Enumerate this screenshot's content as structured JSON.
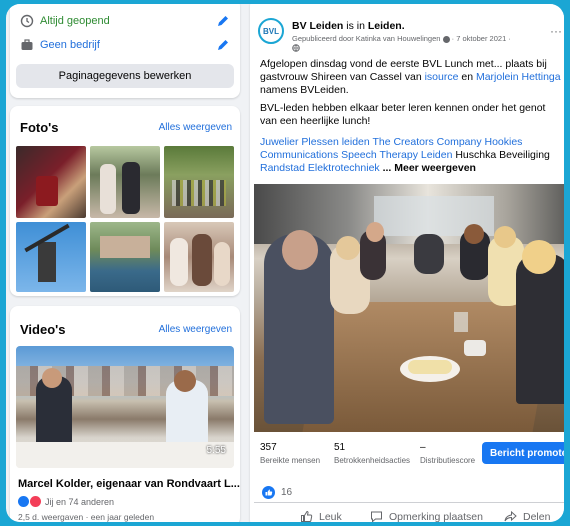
{
  "left": {
    "info": {
      "always_open": "Altijd geopend",
      "no_company": "Geen bedrijf",
      "edit_button": "Paginagegevens bewerken"
    },
    "photos": {
      "title": "Foto's",
      "see_all": "Alles weergeven"
    },
    "videos": {
      "title": "Video's",
      "see_all": "Alles weergeven",
      "duration": "5:55",
      "video_title": "Marcel Kolder, eigenaar van Rondvaart L...",
      "reactions": "Jij en 74 anderen",
      "meta": "2,5 d. weergaven · een jaar geleden"
    }
  },
  "post": {
    "avatar_text": "BVL",
    "page_name": "BV Leiden",
    "is_in": " is in ",
    "location": "Leiden.",
    "published_by": "Gepubliceerd door Katinka van Houwelingen",
    "date": "· 7 oktober 2021 ·",
    "more": "···",
    "p1_a": "Afgelopen dinsdag vond de eerste BVL Lunch met... plaats bij gastvrouw Shireen van Cassel van ",
    "p1_link1": "isource",
    "p1_b": " en ",
    "p1_link2": "Marjolein Hettinga",
    "p1_c": " namens BVLeiden.",
    "p2": "BVL-leden hebben elkaar beter leren kennen onder het genot van een heerlijke lunch!",
    "p3_links": "Juwelier Plessen leiden The Creators Company Hookies Communications  Speech Therapy Leiden",
    "p3_plain": " Huschka Beveiliging ",
    "p3_link2": "Randstad Elektrotechniek",
    "p3_more": " ... Meer weergeven",
    "stats": [
      {
        "value": "357",
        "label": "Bereikte mensen"
      },
      {
        "value": "51",
        "label": "Betrokkenheidsacties"
      },
      {
        "value": "–",
        "label": "Distributiescore"
      }
    ],
    "promote_button": "Bericht promoten",
    "like_count": "16",
    "actions": {
      "like": "Leuk",
      "comment": "Opmerking plaatsen",
      "share": "Delen"
    },
    "colors": {
      "accent": "#1877f2",
      "link": "#216fdb",
      "brand_bg": "#1ba6d4"
    }
  }
}
